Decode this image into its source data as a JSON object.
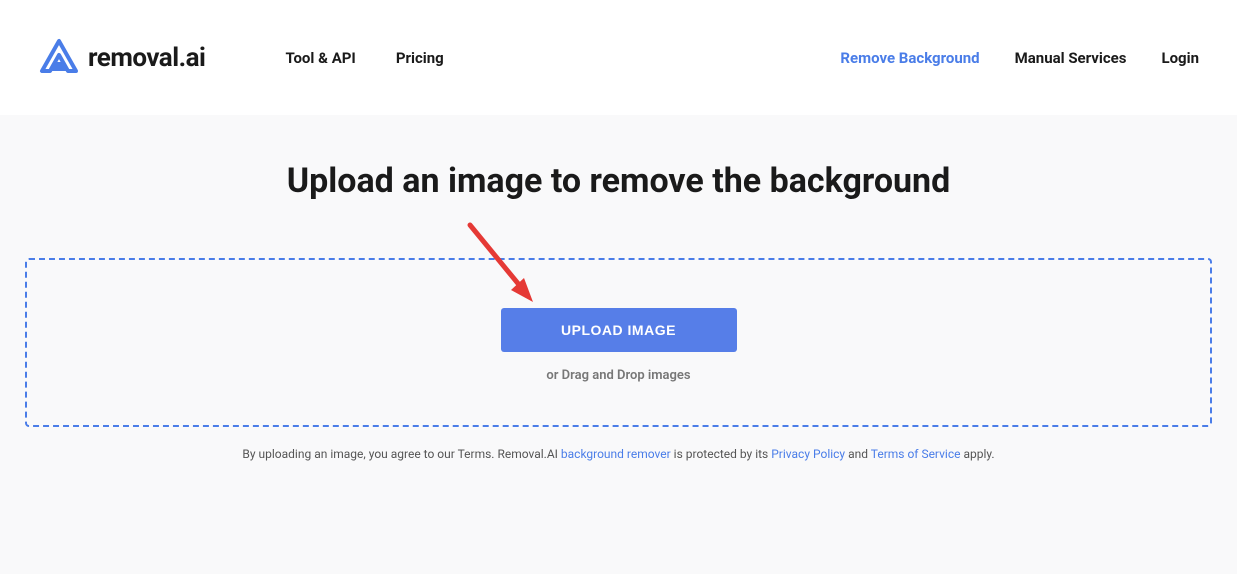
{
  "header": {
    "logo_text": "removal.ai",
    "nav_left": [
      {
        "label": "Tool & API"
      },
      {
        "label": "Pricing"
      }
    ],
    "nav_right": [
      {
        "label": "Remove Background",
        "active": true
      },
      {
        "label": "Manual Services",
        "active": false
      },
      {
        "label": "Login",
        "active": false
      }
    ]
  },
  "main": {
    "title": "Upload an image to remove the background",
    "upload_button": "UPLOAD IMAGE",
    "drag_text": "or Drag and Drop images"
  },
  "disclaimer": {
    "prefix": "By uploading an image, you agree to our Terms. Removal.AI ",
    "link1": "background remover",
    "mid1": " is protected by its ",
    "link2": "Privacy Policy",
    "mid2": " and ",
    "link3": "Terms of Service",
    "suffix": " apply."
  },
  "colors": {
    "accent": "#4a7de8",
    "button": "#567ee8",
    "content_bg": "#f9f9fa",
    "arrow": "#e53935"
  }
}
